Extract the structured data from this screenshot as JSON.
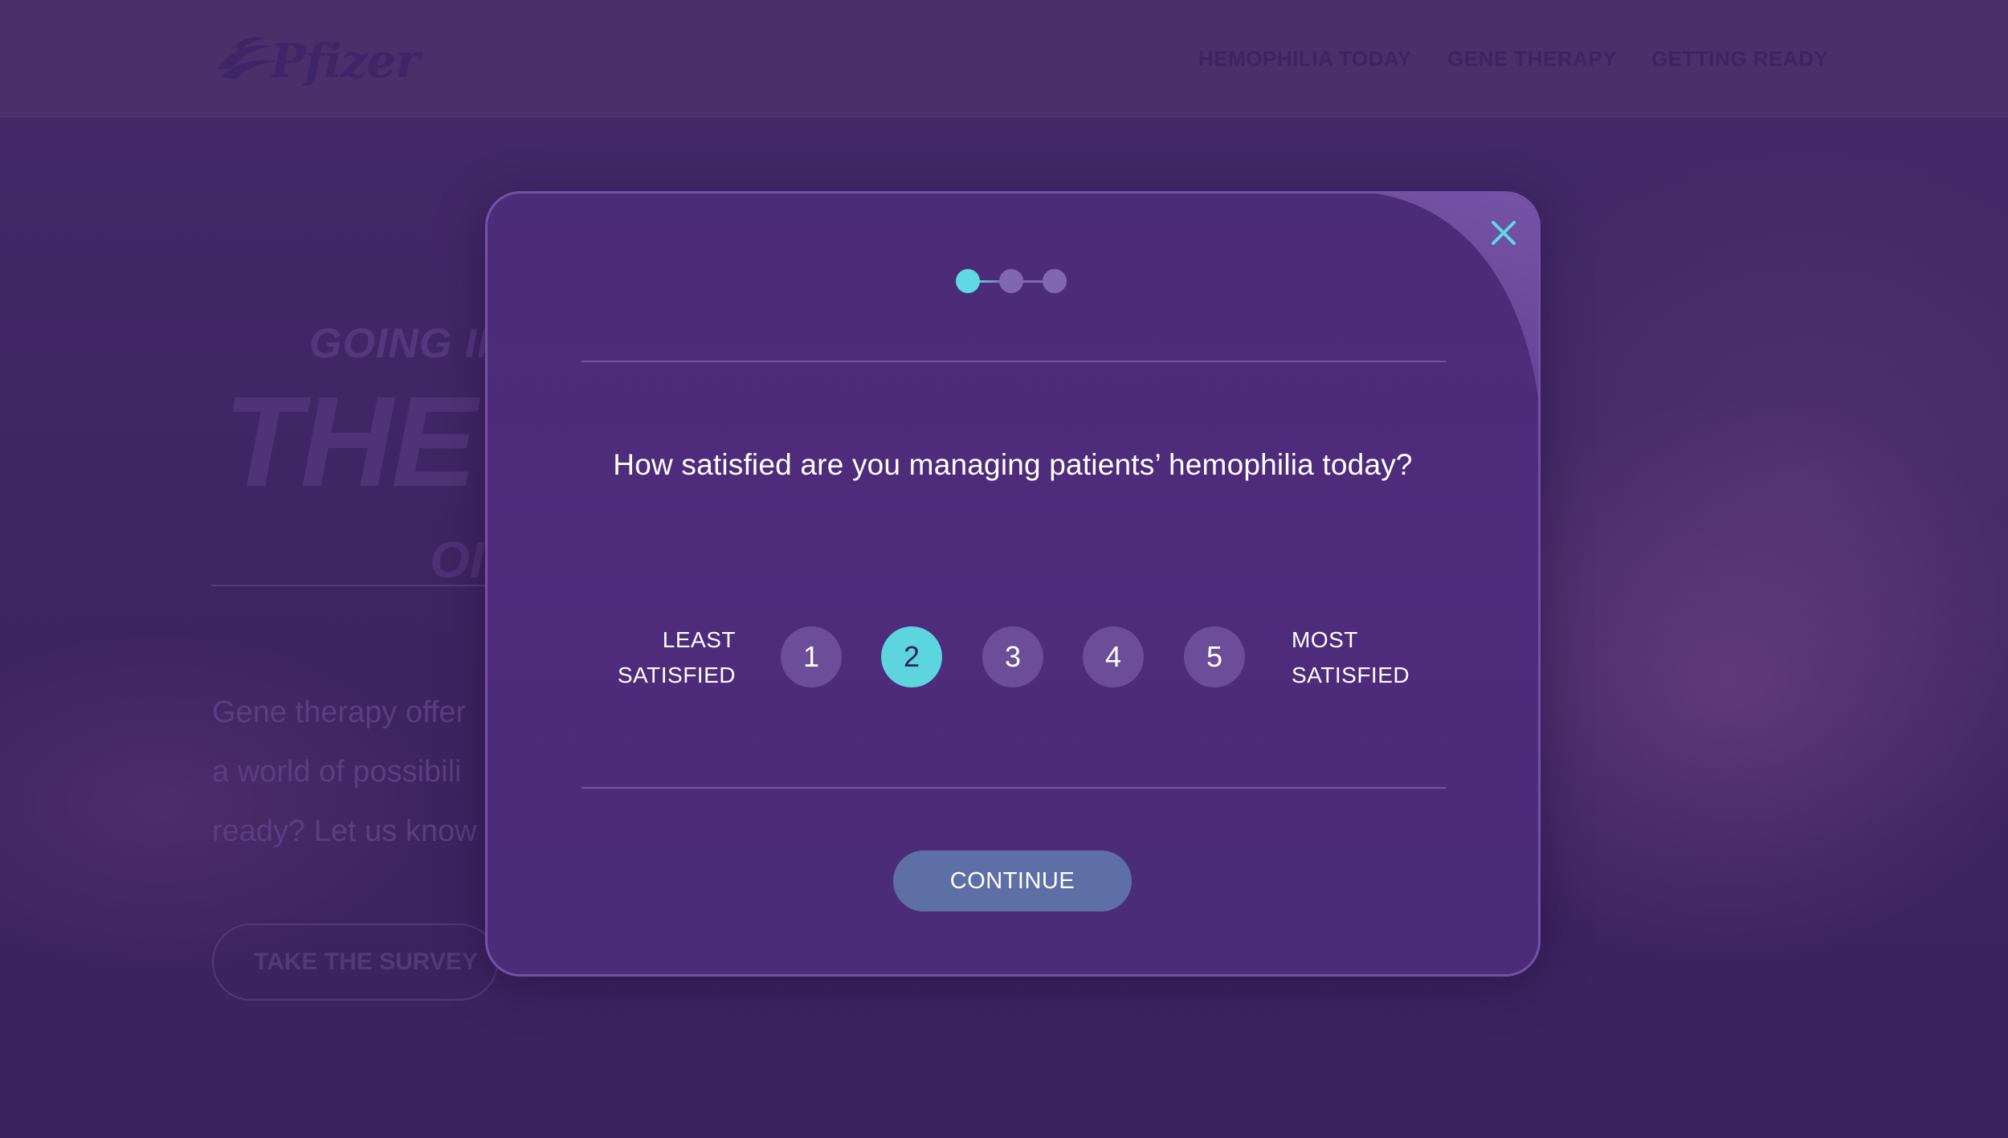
{
  "background": {
    "logo_text": "Pfizer",
    "nav": [
      "HEMOPHILIA TODAY",
      "GENE THERAPY",
      "GETTING READY"
    ],
    "hero": {
      "kicker": "GOING IN",
      "headline": "THE",
      "subheadline": "OI",
      "body_lines": [
        "Gene therapy offer",
        "a world of possibili",
        "ready? Let us know"
      ],
      "cta": "TAKE THE SURVEY"
    }
  },
  "modal": {
    "close_icon": "close-icon",
    "steps": {
      "total": 3,
      "current": 1
    },
    "question": "How satisfied are you managing patients’ hemophilia today?",
    "scale": {
      "least_label_line1": "LEAST",
      "least_label_line2": "SATISFIED",
      "most_label_line1": "MOST",
      "most_label_line2": "SATISFIED",
      "options": [
        "1",
        "2",
        "3",
        "4",
        "5"
      ],
      "selected": "2"
    },
    "continue_label": "CONTINUE"
  },
  "colors": {
    "accent": "#5cd5df",
    "modal_bg": "#4e2b7b",
    "continue_bg": "#5e6fa6",
    "rating_bg": "#6c4d99"
  }
}
